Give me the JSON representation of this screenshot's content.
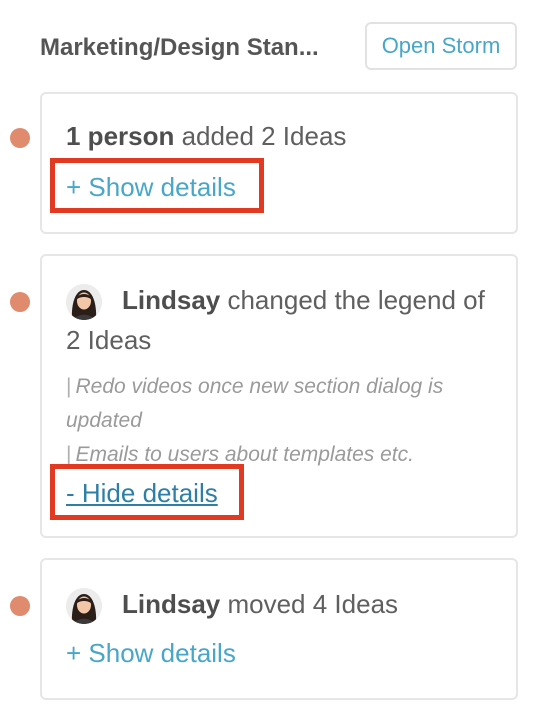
{
  "header": {
    "title": "Marketing/Design Stan...",
    "open_button": "Open Storm"
  },
  "activities": [
    {
      "actor": "1 person",
      "action": " added 2 Ideas",
      "details_toggle": "+ Show details",
      "highlighted": true
    },
    {
      "actor": "Lindsay",
      "action": " changed the legend of 2 Ideas",
      "details": [
        "Redo videos once new section dialog is updated",
        "Emails to users about templates etc."
      ],
      "details_toggle": "- Hide details",
      "highlighted": true
    },
    {
      "actor": "Lindsay",
      "action": " moved 4 Ideas",
      "details_toggle": "+ Show details",
      "highlighted": false
    }
  ],
  "colors": {
    "accent": "#48a7c9",
    "timeline_dot": "#e08a6e",
    "highlight_box": "#e23a22"
  }
}
